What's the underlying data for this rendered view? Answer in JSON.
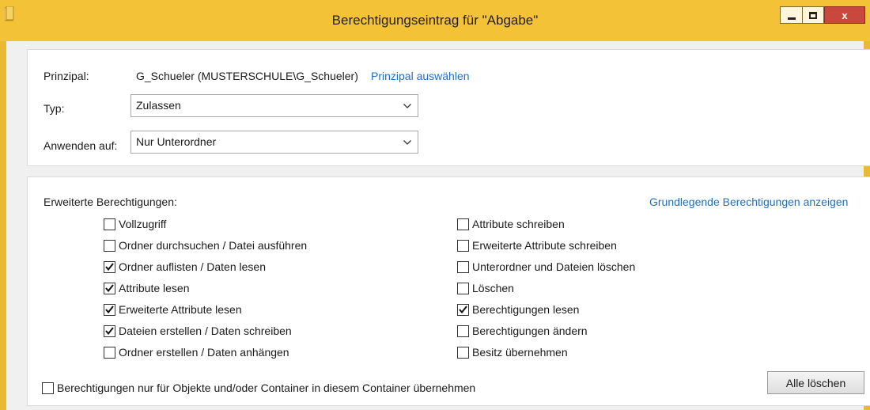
{
  "window": {
    "title": "Berechtigungseintrag für \"Abgabe\""
  },
  "principal": {
    "label": "Prinzipal:",
    "value": "G_Schueler (MUSTERSCHULE\\G_Schueler)",
    "select_link": "Prinzipal auswählen"
  },
  "type": {
    "label": "Typ:",
    "selected": "Zulassen"
  },
  "applies_to": {
    "label": "Anwenden auf:",
    "selected": "Nur Unterordner"
  },
  "advanced": {
    "heading": "Erweiterte Berechtigungen:",
    "basic_link": "Grundlegende Berechtigungen anzeigen",
    "left": [
      {
        "label": "Vollzugriff",
        "checked": false
      },
      {
        "label": "Ordner durchsuchen / Datei ausführen",
        "checked": false
      },
      {
        "label": "Ordner auflisten / Daten lesen",
        "checked": true
      },
      {
        "label": "Attribute lesen",
        "checked": true
      },
      {
        "label": "Erweiterte Attribute lesen",
        "checked": true
      },
      {
        "label": "Dateien erstellen / Daten schreiben",
        "checked": true
      },
      {
        "label": "Ordner erstellen / Daten anhängen",
        "checked": false
      }
    ],
    "right": [
      {
        "label": "Attribute schreiben",
        "checked": false
      },
      {
        "label": "Erweiterte Attribute schreiben",
        "checked": false
      },
      {
        "label": "Unterordner und Dateien löschen",
        "checked": false
      },
      {
        "label": "Löschen",
        "checked": false
      },
      {
        "label": "Berechtigungen lesen",
        "checked": true
      },
      {
        "label": "Berechtigungen ändern",
        "checked": false
      },
      {
        "label": "Besitz übernehmen",
        "checked": false
      }
    ],
    "inherit_only": {
      "label": "Berechtigungen nur für Objekte und/oder Container in diesem Container übernehmen",
      "checked": false
    },
    "clear_all": "Alle löschen"
  },
  "colors": {
    "titlebar": "#f3c237",
    "frame": "#e8b932",
    "link": "#1f6fc0",
    "close": "#c9473c"
  }
}
